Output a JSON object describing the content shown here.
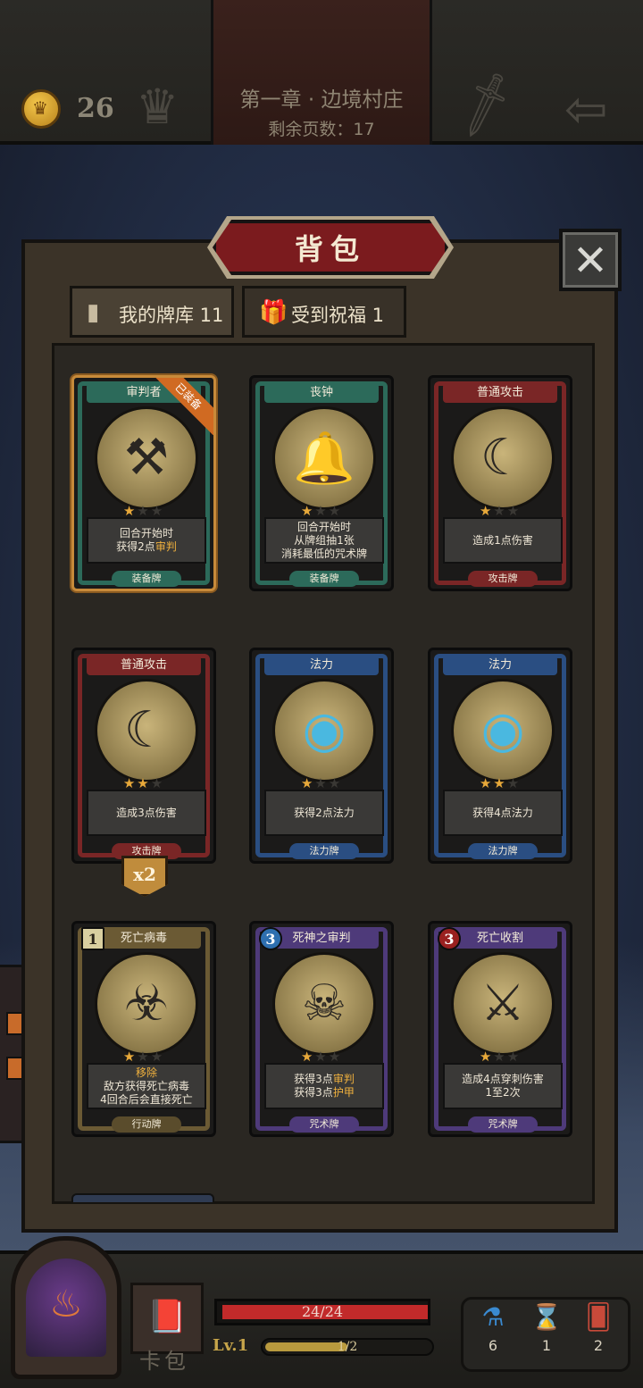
{
  "topbar": {
    "gold": "26",
    "chapter": "第一章 · 边境村庄",
    "pages_left": "剩余页数：17"
  },
  "panel": {
    "title": "背包",
    "close": "✕",
    "tabs": [
      {
        "label": "我的牌库 11",
        "icon": "cards-icon",
        "active": true
      },
      {
        "label": "受到祝福 1",
        "icon": "gift-icon",
        "active": false
      }
    ]
  },
  "cards": [
    {
      "name": "审判者",
      "stars": 1,
      "desc": [
        "回合开始时",
        "获得2点",
        "审判"
      ],
      "type": "装备牌",
      "color": "#2c6a5a",
      "pill": "#2c6a5a",
      "equipped": true,
      "ribbon": "已装备",
      "glyph": "⚒"
    },
    {
      "name": "丧钟",
      "stars": 1,
      "desc": [
        "回合开始时",
        "从牌组抽1张",
        "消耗最低的咒术牌"
      ],
      "type": "装备牌",
      "color": "#2c6a5a",
      "pill": "#2c6a5a",
      "glyph": "🔔"
    },
    {
      "name": "普通攻击",
      "stars": 1,
      "desc": [
        "造成1点伤害"
      ],
      "type": "攻击牌",
      "color": "#7a2626",
      "pill": "#7a2626",
      "glyph": "☾"
    },
    {
      "name": "普通攻击",
      "stars": 2,
      "desc": [
        "造成3点伤害"
      ],
      "type": "攻击牌",
      "color": "#7a2626",
      "pill": "#7a2626",
      "glyph": "☾",
      "count_badge": "x2"
    },
    {
      "name": "法力",
      "stars": 1,
      "desc": [
        "获得2点法力"
      ],
      "type": "法力牌",
      "color": "#2a4e82",
      "pill": "#2a4e82",
      "glyph": "◉"
    },
    {
      "name": "法力",
      "stars": 2,
      "desc": [
        "获得4点法力"
      ],
      "type": "法力牌",
      "color": "#2a4e82",
      "pill": "#2a4e82",
      "glyph": "◉"
    },
    {
      "name": "死亡病毒",
      "cost": "1",
      "stars": 1,
      "desc": [
        "移除",
        "敌方获得死亡病毒",
        "4回合后会直接死亡"
      ],
      "type": "行动牌",
      "color": "#6b5a34",
      "pill": "#5a4c2c",
      "glyph": "☣"
    },
    {
      "name": "死神之审判",
      "cost": "3",
      "stars": 1,
      "desc": [
        "获得3点审判",
        "获得3点护甲"
      ],
      "type": "咒术牌",
      "color": "#4e3a7a",
      "pill": "#4e3a7a",
      "glyph": "☠"
    },
    {
      "name": "死亡收割",
      "cost": "3",
      "stars": 1,
      "desc": [
        "造成4点穿刺伤害",
        "1至2次"
      ],
      "type": "咒术牌",
      "color": "#4e3a7a",
      "pill": "#4e3a7a",
      "glyph": "⚔"
    }
  ],
  "hud": {
    "deck_label": "卡包",
    "hp": "24/24",
    "hp_fraction": 1.0,
    "level": "Lv.1",
    "xp": "1/2",
    "xp_fraction": 0.5,
    "resources": [
      {
        "icon": "potion-icon",
        "value": "6"
      },
      {
        "icon": "hourglass-icon",
        "value": "1"
      },
      {
        "icon": "cards-icon",
        "value": "2"
      }
    ]
  }
}
